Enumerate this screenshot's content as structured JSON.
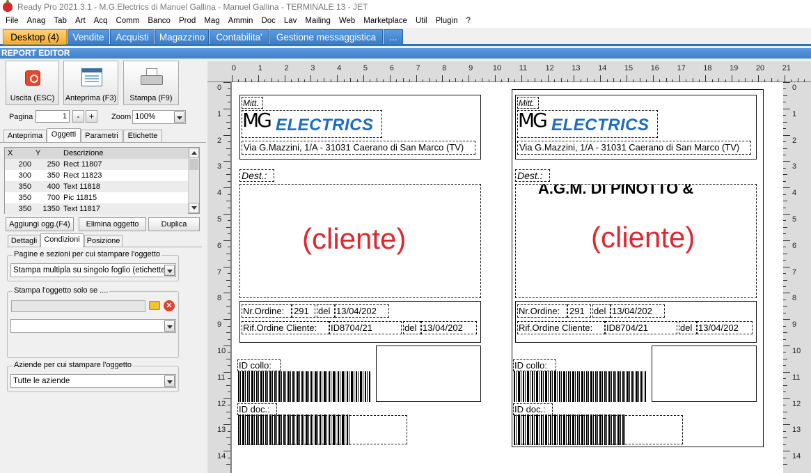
{
  "window": {
    "title": "Ready Pro 2021.3.1 - M.G.Electrics di Manuel Gallina - Manuel Gallina - TERMINALE 13 - JET"
  },
  "menu": [
    "File",
    "Anag",
    "Tab",
    "Art",
    "Acq",
    "Comm",
    "Banco",
    "Prod",
    "Mag",
    "Ammin",
    "Doc",
    "Lav",
    "Mailing",
    "Web",
    "Marketplace",
    "Util",
    "Plugin",
    "?"
  ],
  "main_tabs": [
    "Desktop (4)",
    "Vendite",
    "Acquisti",
    "Magazzino",
    "Contabilita'",
    "Gestione messaggistica",
    "..."
  ],
  "section_title": "REPORT EDITOR",
  "toolbar": {
    "exit": "Uscita (ESC)",
    "preview": "Anteprima (F3)",
    "print": "Stampa (F9)"
  },
  "pager": {
    "label": "Pagina",
    "value": "1",
    "minus": "-",
    "plus": "+",
    "zoom_label": "Zoom",
    "zoom_value": "100%"
  },
  "subtabs": [
    "Anteprima",
    "Oggetti",
    "Parametri",
    "Etichette"
  ],
  "objects_table": {
    "headers": [
      "X",
      "Y",
      "Descrizione"
    ],
    "rows": [
      [
        "200",
        "250",
        "Rect 11807"
      ],
      [
        "300",
        "350",
        "Rect 11823"
      ],
      [
        "350",
        "400",
        "Text 11818"
      ],
      [
        "350",
        "700",
        "Pic 11815"
      ],
      [
        "350",
        "1350",
        "Text 11817"
      ]
    ]
  },
  "object_buttons": {
    "add": "Aggiungi ogg.(F4)",
    "delete": "Elimina oggetto",
    "duplicate": "Duplica"
  },
  "detail_tabs": [
    "Dettagli",
    "Condizioni",
    "Posizione"
  ],
  "conditions": {
    "pages_group": "Pagine e sezioni per cui stampare l'oggetto",
    "pages_value": "Stampa multipla su singolo foglio (etichette)",
    "only_if_group": "Stampa l'oggetto solo se ....",
    "only_if_value": "",
    "companies_group": "Aziende per cui stampare l'oggetto",
    "companies_value": "Tutte le aziende"
  },
  "ruler": {
    "h": [
      "0",
      "1",
      "2",
      "3",
      "4",
      "5",
      "6",
      "7",
      "8",
      "9",
      "10",
      "11",
      "12",
      "13",
      "14",
      "15",
      "16",
      "17",
      "18",
      "19",
      "20",
      "21"
    ],
    "v": [
      "0",
      "1",
      "2",
      "3",
      "4",
      "5",
      "6",
      "7",
      "8",
      "9",
      "10",
      "11",
      "12",
      "13",
      "14"
    ]
  },
  "label": {
    "mitt": "Mitt.",
    "logo_mg": "MG",
    "logo_text": "ELECTRICS",
    "address": "Via G.Mazzini, 1/A - 31031 Caerano di San Marco (TV)",
    "dest": "Dest.:",
    "cliente": "(cliente)",
    "nr_ordine": "Nr.Ordine:",
    "nr_value": "291",
    "del": "del",
    "date": "13/04/202",
    "rif": "Rif.Ordine Cliente:",
    "rif_value": "ID8704/21",
    "id_collo": "ID collo:",
    "id_doc": "ID doc.:",
    "right_partial": "A.G.M. DI PINOTTO &"
  }
}
